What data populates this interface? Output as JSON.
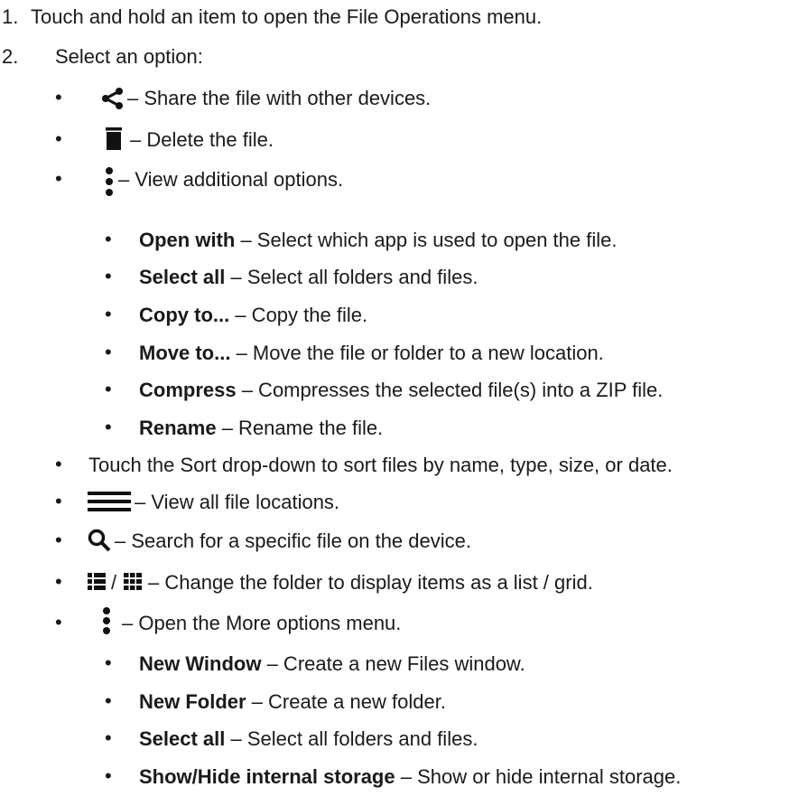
{
  "steps": [
    {
      "number": "1.",
      "text": "Touch and hold an item to open the File Operations menu."
    },
    {
      "number": "2.",
      "text": "Select an option:"
    }
  ],
  "file_ops": [
    {
      "icon": "share-icon",
      "text": "– Share the file with other devices."
    },
    {
      "icon": "trash-icon",
      "text": "– Delete the file."
    },
    {
      "icon": "more-vert-icon",
      "text": "– View additional options."
    }
  ],
  "additional_options": [
    {
      "bold": "Open with",
      "text": " – Select which app is used to open the file."
    },
    {
      "bold": "Select all",
      "text": " – Select all folders and files."
    },
    {
      "bold": "Copy to...",
      "text": " – Copy the file."
    },
    {
      "bold": "Move to...",
      "text": " – Move the file or folder to a new location."
    },
    {
      "bold": "Compress",
      "text": " – Compresses the selected file(s) into a ZIP file."
    },
    {
      "bold": "Rename",
      "text": " – Rename the file."
    }
  ],
  "general_items": [
    {
      "text": "Touch the Sort drop-down to sort files by name, type, size, or date."
    },
    {
      "icon": "menu-icon",
      "text": "– View all file locations."
    },
    {
      "icon": "search-icon",
      "text": "– Search for a specific file on the device."
    },
    {
      "icon": "list-grid-icon",
      "separator": "/",
      "text": "– Change the folder to display items as a list / grid."
    },
    {
      "icon": "more-vert-icon",
      "text": "– Open the More options menu."
    }
  ],
  "more_options": [
    {
      "bold": "New Window",
      "text": " – Create a new Files window."
    },
    {
      "bold": "New Folder",
      "text": " – Create a new folder."
    },
    {
      "bold": "Select all",
      "text": " – Select all folders and files."
    },
    {
      "bold": "Show/Hide internal storage",
      "text": " – Show or hide internal storage."
    }
  ],
  "bullet": "•"
}
